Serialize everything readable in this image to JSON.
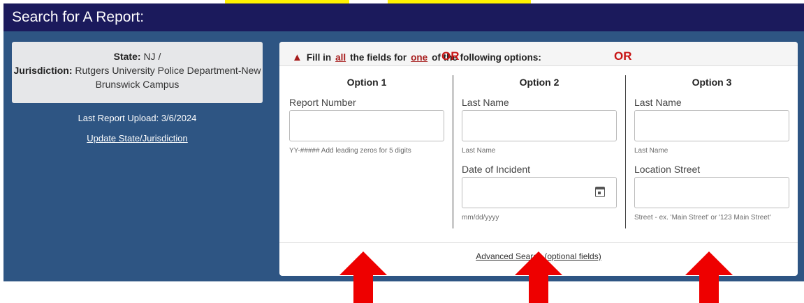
{
  "header": {
    "title": "Search for A Report:"
  },
  "sidebar": {
    "state_label": "State:",
    "state_value": "NJ",
    "separator": "/",
    "jurisdiction_label": "Jurisdiction:",
    "jurisdiction_value": "Rutgers University Police Department-New Brunswick Campus",
    "last_upload": "Last Report Upload: 3/6/2024",
    "update_link": "Update State/Jurisdiction"
  },
  "panel": {
    "instruction_pre": "Fill in",
    "instruction_all": "all",
    "instruction_mid": "the fields for",
    "instruction_one": "one",
    "instruction_post": "of the following options:",
    "or_label": "OR",
    "option1": {
      "title": "Option 1",
      "field1_label": "Report Number",
      "field1_help": "YY-##### Add leading zeros for 5 digits"
    },
    "option2": {
      "title": "Option 2",
      "field1_label": "Last Name",
      "field1_help": "Last Name",
      "field2_label": "Date of Incident",
      "field2_help": "mm/dd/yyyy"
    },
    "option3": {
      "title": "Option 3",
      "field1_label": "Last Name",
      "field1_help": "Last Name",
      "field2_label": "Location Street",
      "field2_help": "Street - ex. 'Main Street' or '123 Main Street'"
    },
    "advanced_link": "Advanced Search (optional fields)"
  },
  "icons": {
    "warning": "warning-triangle-icon",
    "calendar": "calendar-icon",
    "arrow": "up-arrow-icon"
  },
  "colors": {
    "header_bg": "#1b1a5c",
    "body_bg": "#2e5583",
    "accent_red": "#c81414",
    "highlight": "#fff200"
  }
}
